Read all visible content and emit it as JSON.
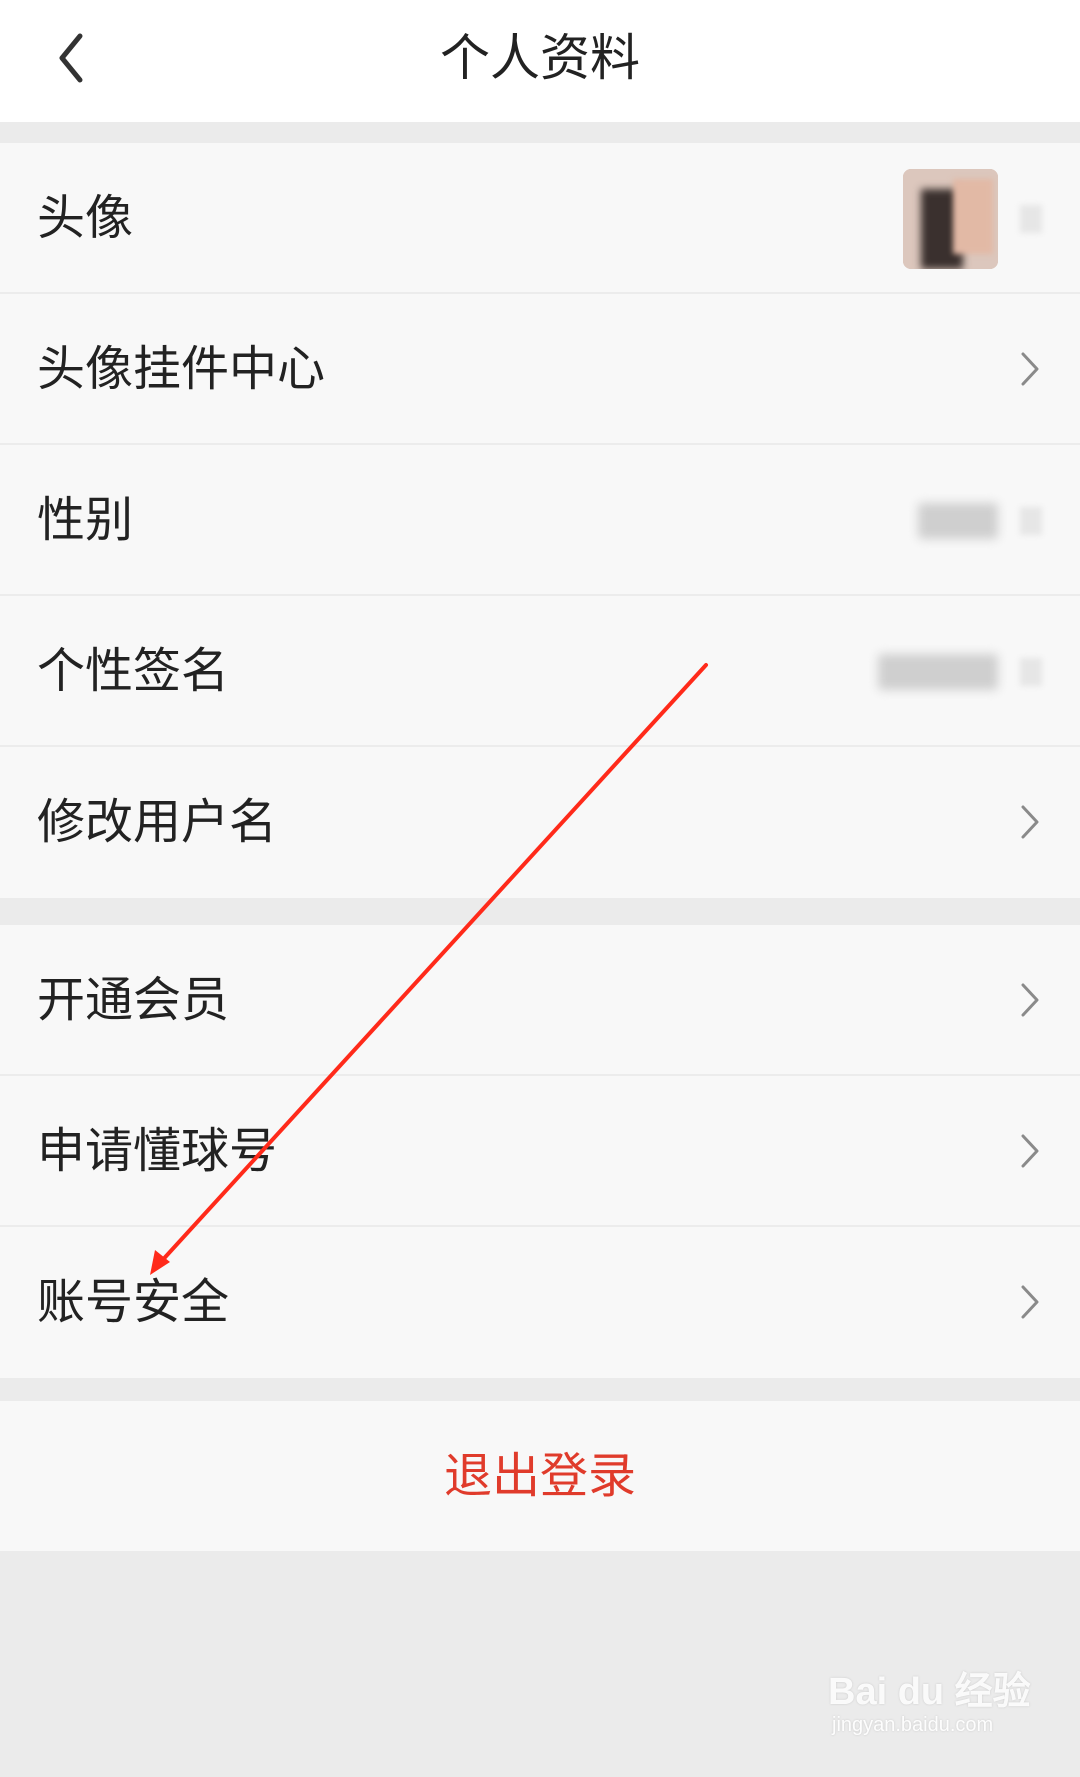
{
  "header": {
    "title": "个人资料",
    "back_icon": "chevron-left-icon"
  },
  "profile_group": {
    "items": [
      {
        "label": "头像",
        "value_type": "avatar-image"
      },
      {
        "label": "头像挂件中心",
        "value_type": "chevron"
      },
      {
        "label": "性别",
        "value_type": "blurred"
      },
      {
        "label": "个性签名",
        "value_type": "blurred"
      },
      {
        "label": "修改用户名",
        "value_type": "chevron"
      }
    ]
  },
  "account_group": {
    "items": [
      {
        "label": "开通会员"
      },
      {
        "label": "申请懂球号"
      },
      {
        "label": "账号安全"
      }
    ]
  },
  "logout": {
    "label": "退出登录",
    "color": "#e03b2b"
  },
  "annotation": {
    "arrow_color": "#ff2a1a"
  },
  "watermark": {
    "brand": "Bai du 经验",
    "url": "jingyan.baidu.com"
  }
}
